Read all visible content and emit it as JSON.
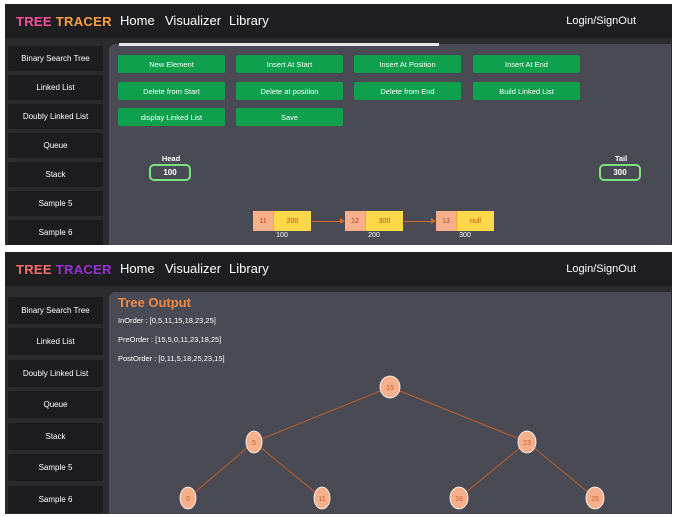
{
  "top": {
    "brand": {
      "part1": "TREE",
      "part2": "TRACER"
    },
    "nav": {
      "home": "Home",
      "visualizer": "Visualizer",
      "library": "Library",
      "login": "Login/SignOut"
    },
    "sidebar": [
      "Binary Search Tree",
      "Linked List",
      "Doubly Linked List",
      "Queue",
      "Stack",
      "Sample 5",
      "Sample 6"
    ],
    "buttons": [
      "New Element",
      "Insert At Start",
      "Insert At Position",
      "Insert At End",
      "Delete from Start",
      "Delete at position",
      "Delete from End",
      "Build Linked List",
      "display Linked List",
      "Save"
    ],
    "head": {
      "label": "Head",
      "value": "100"
    },
    "tail": {
      "label": "Tail",
      "value": "300"
    },
    "nodes": [
      {
        "val": "11",
        "next": "200",
        "addr": "100"
      },
      {
        "val": "12",
        "next": "300",
        "addr": "200"
      },
      {
        "val": "13",
        "next": "null",
        "addr": "300"
      }
    ]
  },
  "bottom": {
    "brand": {
      "part1": "TREE",
      "part2": "TRACER"
    },
    "nav": {
      "home": "Home",
      "visualizer": "Visualizer",
      "library": "Library",
      "login": "Login/SignOut"
    },
    "sidebar": [
      "Binary Search Tree",
      "Linked List",
      "Doubly Linked List",
      "Queue",
      "Stack",
      "Sample 5",
      "Sample 6"
    ],
    "title": "Tree Output",
    "inorder": "InOrder : [0,5,11,15,18,23,25]",
    "preorder": "PreOrder : [15,5,0,11,23,18,25]",
    "postorder": "PostOrder : [0,11,5,18,25,23,15]",
    "tree": {
      "root": "15",
      "level1": [
        "5",
        "23"
      ],
      "level2": [
        "0",
        "11",
        "18",
        "25"
      ]
    }
  },
  "colors": {
    "button": "#0ea04c",
    "panel": "#4a4a55",
    "node_orange": "#f7b08c",
    "accent": "#ee8a45"
  }
}
